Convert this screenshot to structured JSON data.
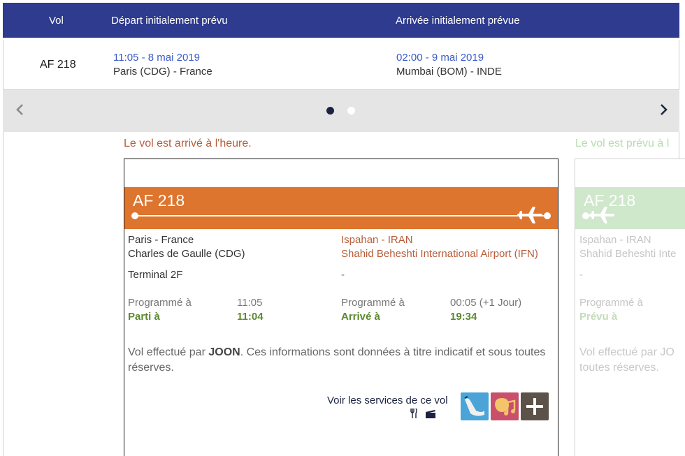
{
  "header": {
    "col_vol": "Vol",
    "col_depart": "Départ initialement prévu",
    "col_arrivee": "Arrivée initialement prévue"
  },
  "flight_row": {
    "flight": "AF 218",
    "depart_time": "11:05 - 8 mai 2019",
    "depart_city": "Paris (CDG) - France",
    "arrival_time": "02:00 - 9 mai 2019",
    "arrival_city": "Mumbai (BOM) - INDE"
  },
  "carousel": {
    "prev_icon": "chevron-left-icon",
    "next_icon": "chevron-right-icon",
    "active_index": 0,
    "count": 2
  },
  "leg1": {
    "status": "Le vol est arrivé à l'heure.",
    "flight": "AF 218",
    "origin_line1": "Paris - France",
    "origin_line2": "Charles de Gaulle (CDG)",
    "origin_terminal": "Terminal 2F",
    "dest_line1": "Ispahan - IRAN",
    "dest_line2": "Shahid Beheshti International Airport (IFN)",
    "dest_terminal": "-",
    "dep_sched_label": "Programmé à",
    "dep_sched_time": "11:05",
    "dep_actual_label": "Parti à",
    "dep_actual_time": "11:04",
    "arr_sched_label": "Programmé à",
    "arr_sched_time": "00:05  (+1 Jour)",
    "arr_actual_label": "Arrivé à",
    "arr_actual_time": "19:34",
    "note_prefix": "Vol effectué par ",
    "note_operator": "JOON",
    "note_suffix": ". Ces informations sont données à titre indicatif et sous toutes réserves.",
    "services_label": "Voir les services de ce vol",
    "services_icons": [
      "meal-icon",
      "movie-icon"
    ]
  },
  "leg2": {
    "status": "Le vol est prévu à l",
    "flight": "AF 218",
    "dest_line1": "Ispahan - IRAN",
    "dest_line2": "Shahid Beheshti Inte",
    "terminal": "-",
    "sched_label": "Programmé à",
    "planned_label": "Prévu à",
    "note_line1": "Vol effectué par JO",
    "note_line2": "toutes réserves."
  },
  "colors": {
    "header_bg": "#2e3b8e",
    "band": "#dd752e",
    "band_faded": "#cfe7cb",
    "status_text": "#b85c3a",
    "time_blue": "#3a5bc7",
    "green": "#5a8a2f"
  }
}
